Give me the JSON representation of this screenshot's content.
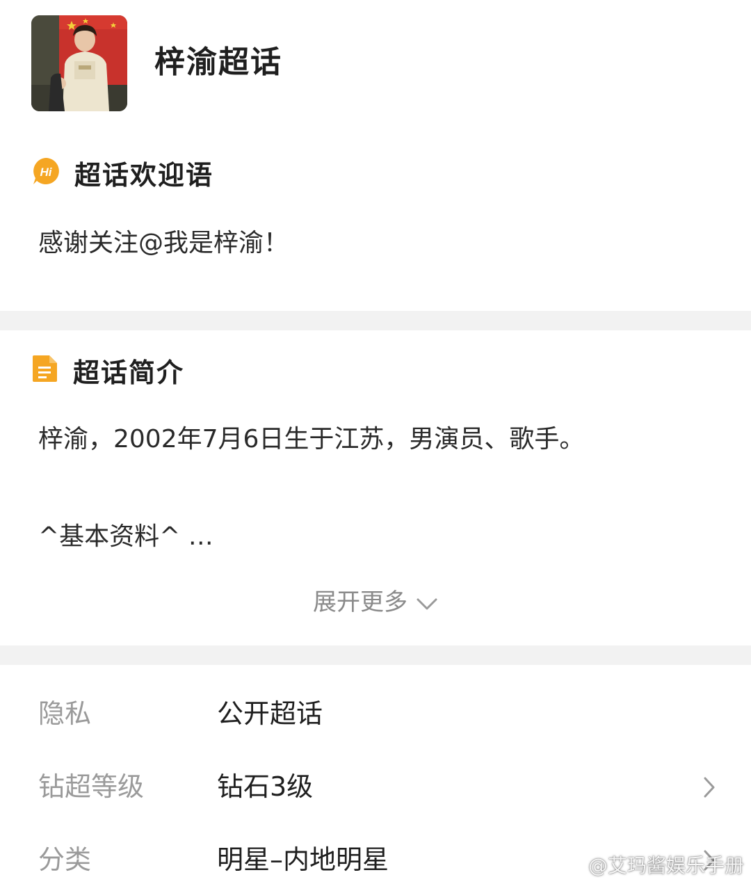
{
  "header": {
    "title": "梓渝超话"
  },
  "welcome": {
    "heading": "超话欢迎语",
    "icon": "hi-icon",
    "icon_text": "Hi",
    "text": "感谢关注@我是梓渝！"
  },
  "intro": {
    "heading": "超话简介",
    "icon": "document-icon",
    "line1": "梓渝，2002年7月6日生于江苏，男演员、歌手。",
    "line2": "^基本资料^ …",
    "expand_label": "展开更多"
  },
  "info": {
    "rows": [
      {
        "key": "隐私",
        "value": "公开超话",
        "has_arrow": false
      },
      {
        "key": "钻超等级",
        "value": "钻石3级",
        "has_arrow": true
      },
      {
        "key": "分类",
        "value": "明星–内地明星",
        "has_arrow": true
      }
    ]
  },
  "watermark": {
    "text": "@艾玛酱娱乐手册"
  },
  "colors": {
    "accent_orange": "#f5a623",
    "divider": "#f2f2f2"
  }
}
